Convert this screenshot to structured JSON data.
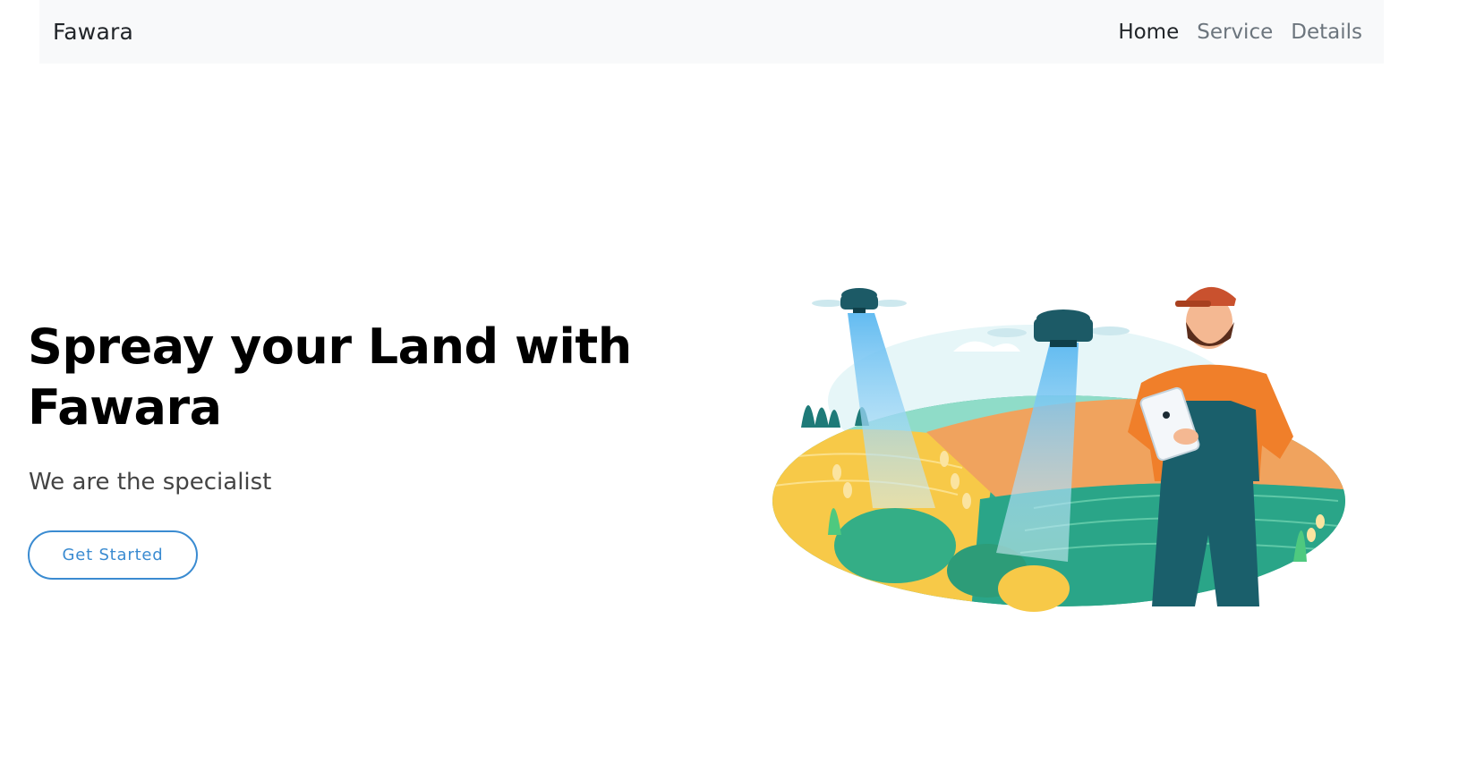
{
  "navbar": {
    "brand": "Fawara",
    "links": [
      "Home",
      "Service",
      "Details"
    ],
    "active_link": "Home"
  },
  "hero": {
    "title": "Spreay your Land with Fawara",
    "subtitle": "We are the specialist",
    "cta_label": "Get Started"
  },
  "colors": {
    "navbar_bg": "#f8f9fa",
    "nav_active": "#212529",
    "nav_inactive": "#6c757d",
    "button_accent": "#3a8bd1",
    "field_yellow": "#f7c948",
    "field_orange": "#f0a35e",
    "field_green": "#2fa98c",
    "farmer_shirt": "#f07f2a",
    "farmer_overalls": "#1a5f6b",
    "drone_body": "#1c5a66"
  },
  "illustration": {
    "subject": "farmer-with-tablet-and-spraying-drones"
  }
}
